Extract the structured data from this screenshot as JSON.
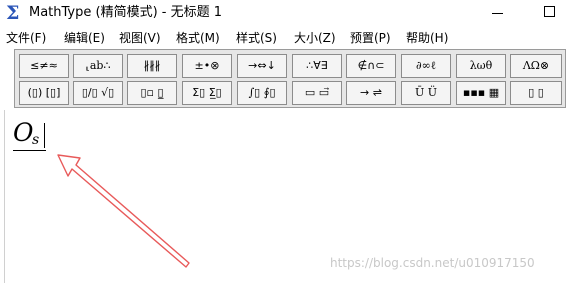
{
  "window": {
    "title": "MathType (精简模式) - 无标题 1",
    "app_icon": "Σ"
  },
  "menu": [
    "文件(F)",
    "编辑(E)",
    "视图(V)",
    "格式(M)",
    "样式(S)",
    "大小(Z)",
    "预置(P)",
    "帮助(H)"
  ],
  "toolbar": {
    "row1": [
      "≤≠≈",
      "⸤ab∴",
      "∦∦∦",
      "±•⊗",
      "→⇔↓",
      "∴∀∃",
      "∉∩⊂",
      "∂∞ℓ",
      "λωθ",
      "ΛΩ⊗"
    ],
    "row2": [
      "(▯) [▯]",
      "▯/▯ √▯",
      "▯▫ ▯̲",
      "Σ▯ Σ̲▯",
      "∫▯ ∮▯",
      "▭ ▭⃗",
      "→ ⇌",
      "Ū Ü",
      "▪▪▪ ▦",
      "▯ ▯"
    ]
  },
  "editor": {
    "formula_base": "O",
    "formula_subscript": "s"
  },
  "watermark": "https://blog.csdn.net/u010917150"
}
